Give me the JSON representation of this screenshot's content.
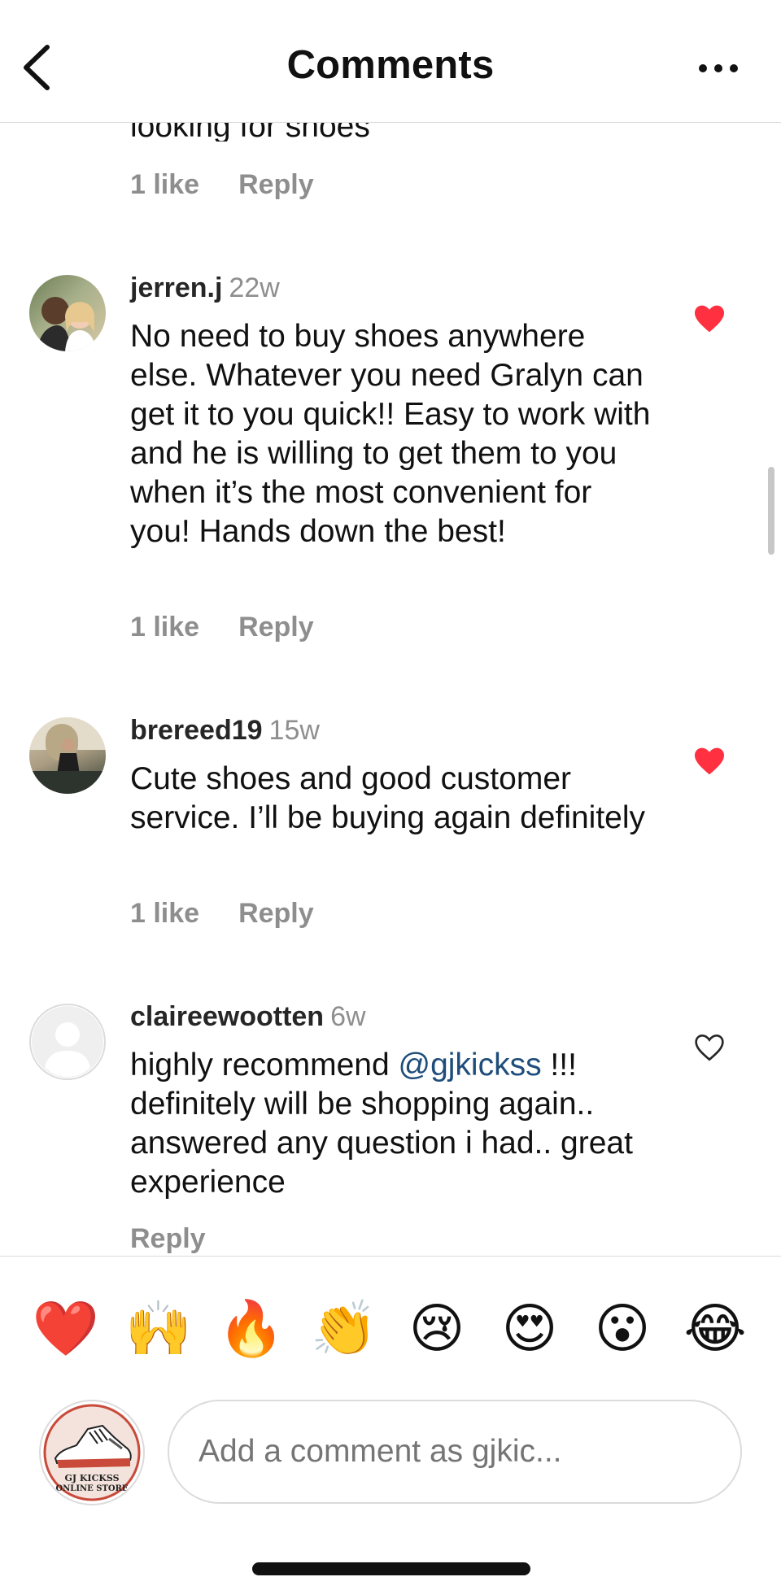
{
  "header": {
    "title": "Comments"
  },
  "partial_comment": {
    "text": "looking for shoes",
    "likes": "1 like",
    "reply": "Reply"
  },
  "comments": [
    {
      "username": "jerren.j",
      "time": "22w",
      "text": "No need to buy shoes anywhere else. Whatever you need Gralyn can get it to you quick!! Easy to work with and he is willing to get them to you when it’s the most convenient for you! Hands down the best!",
      "likes": "1 like",
      "reply": "Reply",
      "liked": true
    },
    {
      "username": "brereed19",
      "time": "15w",
      "text": "Cute shoes and good customer service. I’ll be buying again definitely",
      "likes": "1 like",
      "reply": "Reply",
      "liked": true
    },
    {
      "username": "claireewootten",
      "time": "6w",
      "text_before": "highly recommend ",
      "mention": "@gjkickss",
      "text_after": " !!! definitely will be shopping again.. answered any question i had.. great experience",
      "reply": "Reply",
      "liked": false
    }
  ],
  "reactions": [
    "❤️",
    "🙌",
    "🔥",
    "👏",
    "😢",
    "😍",
    "😮",
    "😂"
  ],
  "composer": {
    "placeholder": "Add a comment as gjkic...",
    "avatar_text_line1": "GJ KICKSS",
    "avatar_text_line2": "ONLINE STORE"
  },
  "colors": {
    "heart_red": "#ff3040",
    "mention": "#1e4d7b",
    "secondary_text": "#8e8e8e"
  }
}
